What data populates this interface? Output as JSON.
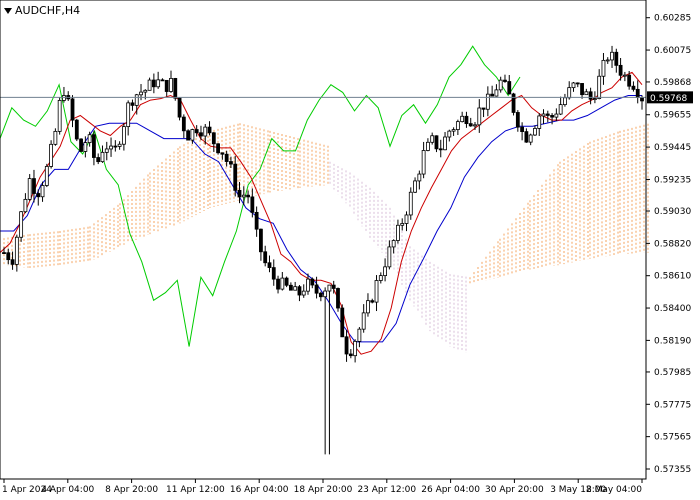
{
  "header": {
    "symbol_label": "AUDCHF,H4"
  },
  "chart_data": {
    "type": "candlestick",
    "symbol": "AUDCHF",
    "timeframe": "H4",
    "current_price": "0.59768",
    "y_ticks": [
      "0.60285",
      "0.60075",
      "0.59868",
      "0.59655",
      "0.59445",
      "0.59235",
      "0.59030",
      "0.58820",
      "0.58610",
      "0.58400",
      "0.58190",
      "0.57985",
      "0.57775",
      "0.57565",
      "0.57355"
    ],
    "y_tick_values": [
      0.60285,
      0.60075,
      0.59868,
      0.59655,
      0.59445,
      0.59235,
      0.5903,
      0.5882,
      0.5861,
      0.584,
      0.5819,
      0.57985,
      0.57775,
      0.57565,
      0.57355
    ],
    "x_ticks": [
      "1 Apr 2024",
      "4 Apr 04:00",
      "8 Apr 20:00",
      "11 Apr 12:00",
      "16 Apr 04:00",
      "18 Apr 20:00",
      "23 Apr 12:00",
      "26 Apr 04:00",
      "30 Apr 20:00",
      "3 May 12:00",
      "8 May 04:00"
    ],
    "ylim": [
      0.5729,
      0.604
    ],
    "close_path": [
      0.5876,
      0.5872,
      0.59,
      0.5924,
      0.5915,
      0.5928,
      0.595,
      0.5985,
      0.5965,
      0.594,
      0.5952,
      0.5932,
      0.5948,
      0.5938,
      0.5955,
      0.5975,
      0.598,
      0.5982,
      0.5988,
      0.5984,
      0.5986,
      0.5962,
      0.5952,
      0.5958,
      0.5955,
      0.5948,
      0.5942,
      0.593,
      0.5912,
      0.5915,
      0.5888,
      0.587,
      0.586,
      0.5855,
      0.5852,
      0.5848,
      0.5856,
      0.585,
      0.5852,
      0.5858,
      0.583,
      0.581,
      0.5822,
      0.5835,
      0.585,
      0.5865,
      0.5878,
      0.589,
      0.5905,
      0.5922,
      0.594,
      0.5948,
      0.5944,
      0.5955,
      0.596,
      0.5965,
      0.5962,
      0.5972,
      0.5975,
      0.5988,
      0.598,
      0.5965,
      0.595,
      0.5958,
      0.5968,
      0.5962,
      0.597,
      0.5978,
      0.5985,
      0.598,
      0.5975,
      0.599,
      0.6005,
      0.5998,
      0.599,
      0.5986,
      0.5977
    ],
    "tenkan": [
      0.5876,
      0.5882,
      0.5895,
      0.591,
      0.5925,
      0.5935,
      0.5945,
      0.5962,
      0.5965,
      0.596,
      0.5955,
      0.5952,
      0.5958,
      0.5962,
      0.5972,
      0.5975,
      0.5976,
      0.5978,
      0.5975,
      0.5962,
      0.595,
      0.5945,
      0.5944,
      0.5944,
      0.5935,
      0.5925,
      0.591,
      0.5895,
      0.5875,
      0.587,
      0.5862,
      0.5858,
      0.5858,
      0.5856,
      0.5842,
      0.5818,
      0.581,
      0.5812,
      0.582,
      0.584,
      0.587,
      0.589,
      0.5905,
      0.5918,
      0.593,
      0.5942,
      0.595,
      0.5955,
      0.596,
      0.5965,
      0.597,
      0.5975,
      0.5978,
      0.597,
      0.5965,
      0.5962,
      0.5962,
      0.5968,
      0.5972,
      0.5975,
      0.598,
      0.5983,
      0.599,
      0.5993,
      0.5985
    ],
    "kijun": [
      0.589,
      0.589,
      0.59,
      0.592,
      0.593,
      0.593,
      0.5945,
      0.5958,
      0.596,
      0.596,
      0.596,
      0.5955,
      0.595,
      0.595,
      0.595,
      0.594,
      0.5935,
      0.592,
      0.5905,
      0.5898,
      0.5895,
      0.5878,
      0.5865,
      0.5858,
      0.5845,
      0.583,
      0.5818,
      0.5818,
      0.5818,
      0.583,
      0.5855,
      0.5872,
      0.589,
      0.5905,
      0.5925,
      0.5938,
      0.5948,
      0.5955,
      0.5958,
      0.5958,
      0.596,
      0.5962,
      0.5962,
      0.5965,
      0.597,
      0.5975,
      0.5978,
      0.5978
    ],
    "chikou": [
      0.595,
      0.597,
      0.5962,
      0.5958,
      0.5968,
      0.5985,
      0.5948,
      0.594,
      0.5955,
      0.593,
      0.592,
      0.5888,
      0.587,
      0.5845,
      0.585,
      0.5858,
      0.5815,
      0.586,
      0.5848,
      0.587,
      0.589,
      0.592,
      0.593,
      0.595,
      0.5942,
      0.5942,
      0.5962,
      0.5975,
      0.5985,
      0.598,
      0.5968,
      0.5978,
      0.597,
      0.5945,
      0.5965,
      0.5972,
      0.596,
      0.5972,
      0.599,
      0.5998,
      0.601,
      0.5998,
      0.599,
      0.5978,
      0.599
    ],
    "kumo_bull": [
      [
        0.5885,
        0.5868
      ],
      [
        0.5888,
        0.5866
      ],
      [
        0.589,
        0.5868
      ],
      [
        0.5893,
        0.587
      ],
      [
        0.5908,
        0.588
      ],
      [
        0.5928,
        0.5888
      ],
      [
        0.5945,
        0.5895
      ],
      [
        0.5955,
        0.5905
      ],
      [
        0.596,
        0.591
      ],
      [
        0.5955,
        0.5915
      ],
      [
        0.595,
        0.5918
      ],
      [
        0.5945,
        0.592
      ]
    ],
    "kumo_bear": [
      [
        0.5935,
        0.592
      ],
      [
        0.5928,
        0.5905
      ],
      [
        0.5918,
        0.5885
      ],
      [
        0.5905,
        0.587
      ],
      [
        0.588,
        0.5845
      ],
      [
        0.587,
        0.5825
      ],
      [
        0.5862,
        0.5815
      ],
      [
        0.586,
        0.581
      ]
    ],
    "kumo_bull2": [
      [
        0.586,
        0.5855
      ],
      [
        0.5885,
        0.586
      ],
      [
        0.591,
        0.5865
      ],
      [
        0.5935,
        0.5868
      ],
      [
        0.5948,
        0.5872
      ],
      [
        0.5955,
        0.5875
      ],
      [
        0.596,
        0.5876
      ]
    ],
    "colors": {
      "candle": "#000000",
      "tenkan": "#cc0000",
      "kijun": "#0000cc",
      "chikou": "#00cc00",
      "kumo_bull": "#f4a460",
      "kumo_bear": "#d8bfd8",
      "price_line": "#708090",
      "price_label_bg": "#000000"
    }
  }
}
